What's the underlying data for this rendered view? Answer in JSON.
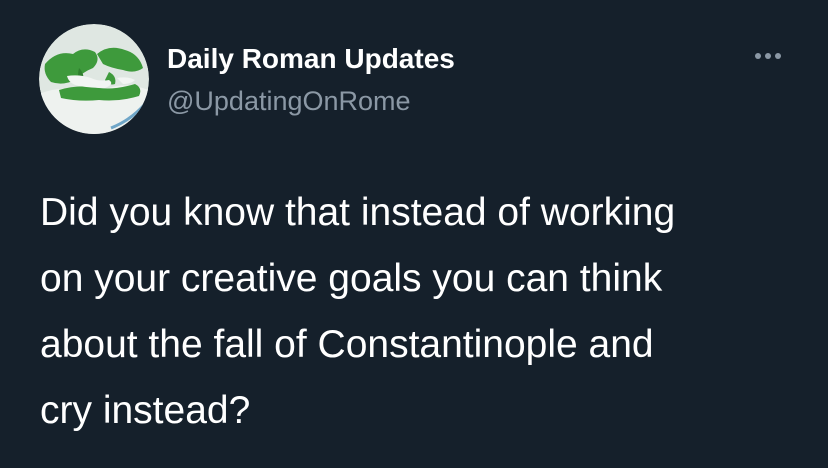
{
  "tweet": {
    "author": {
      "display_name": "Daily Roman Updates",
      "handle": "@UpdatingOnRome",
      "avatar_icon": "roman-empire-map-avatar"
    },
    "more_icon": "more-options-icon",
    "text": "Did you know that instead of working\non your creative goals you can think\nabout the fall of Constantinople and\ncry instead?"
  },
  "colors": {
    "background": "#15202b",
    "text_primary": "#ffffff",
    "text_secondary": "#8b98a5",
    "map_land": "#d9e2dd",
    "map_empire": "#3e9a3c",
    "map_sea": "#f2f5f3"
  }
}
